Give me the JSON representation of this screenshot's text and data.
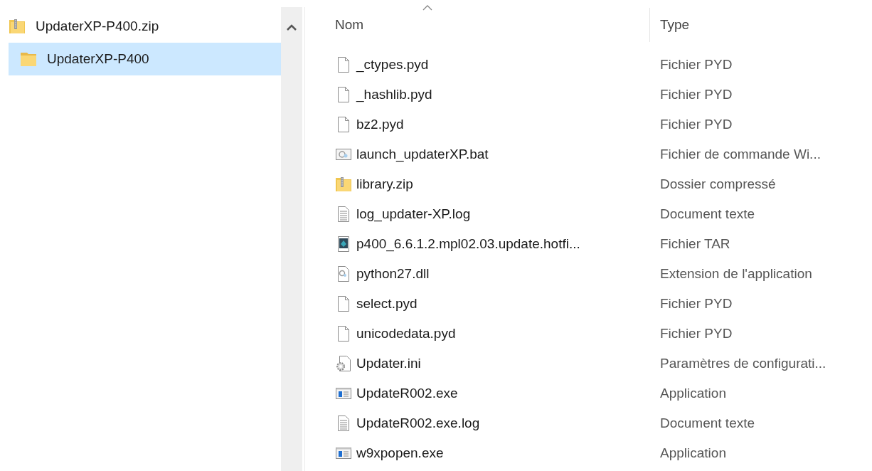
{
  "navigation": {
    "items": [
      {
        "label": "UpdaterXP-P400.zip",
        "kind": "zip",
        "selected": false,
        "children": [
          {
            "label": "UpdaterXP-P400",
            "kind": "folder",
            "selected": true
          }
        ]
      }
    ]
  },
  "file_list": {
    "columns": [
      {
        "label": "Nom",
        "sorted": true
      },
      {
        "label": "Type",
        "sorted": false
      }
    ],
    "rows": [
      {
        "name": "_ctypes.pyd",
        "type": "Fichier PYD",
        "kind": "blank"
      },
      {
        "name": "_hashlib.pyd",
        "type": "Fichier PYD",
        "kind": "blank"
      },
      {
        "name": "bz2.pyd",
        "type": "Fichier PYD",
        "kind": "blank"
      },
      {
        "name": "launch_updaterXP.bat",
        "type": "Fichier de commande Wi...",
        "kind": "batch"
      },
      {
        "name": "library.zip",
        "type": "Dossier compressé",
        "kind": "zip"
      },
      {
        "name": "log_updater-XP.log",
        "type": "Document texte",
        "kind": "text"
      },
      {
        "name": "p400_6.6.1.2.mpl02.03.update.hotfi...",
        "type": "Fichier TAR",
        "kind": "archive"
      },
      {
        "name": "python27.dll",
        "type": "Extension de l'application",
        "kind": "dll"
      },
      {
        "name": "select.pyd",
        "type": "Fichier PYD",
        "kind": "blank"
      },
      {
        "name": "unicodedata.pyd",
        "type": "Fichier PYD",
        "kind": "blank"
      },
      {
        "name": "Updater.ini",
        "type": "Paramètres de configurati...",
        "kind": "settings"
      },
      {
        "name": "UpdateR002.exe",
        "type": "Application",
        "kind": "exe"
      },
      {
        "name": "UpdateR002.exe.log",
        "type": "Document texte",
        "kind": "text"
      },
      {
        "name": "w9xpopen.exe",
        "type": "Application",
        "kind": "exe"
      }
    ]
  }
}
